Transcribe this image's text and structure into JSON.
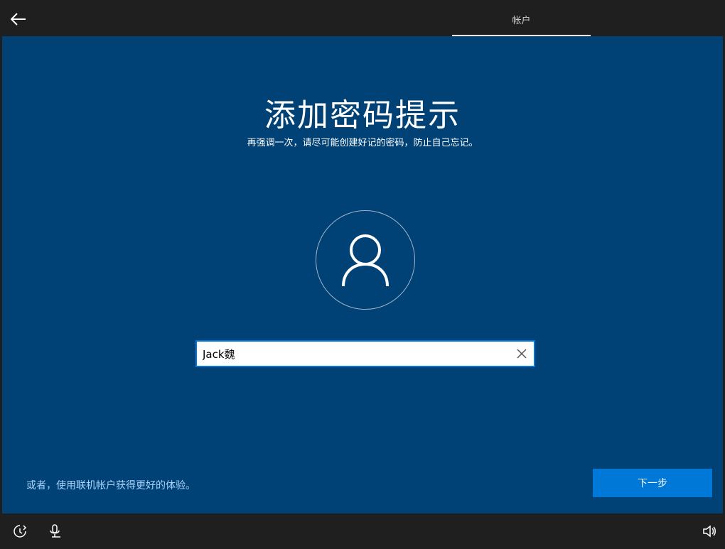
{
  "topbar": {
    "back_icon": "back-arrow-icon",
    "tab_label": "帐户"
  },
  "main": {
    "title": "添加密码提示",
    "subtitle": "再强调一次，请尽可能创建好记的密码，防止自己忘记。",
    "avatar_icon": "user-icon",
    "hint_input": {
      "value": "Jack魏",
      "clear_icon": "close-icon"
    },
    "online_account_link": "或者，使用联机帐户获得更好的体验。",
    "next_button": "下一步"
  },
  "bottombar": {
    "ease_of_access_icon": "ease-of-access-icon",
    "microphone_icon": "microphone-icon",
    "volume_icon": "volume-icon"
  },
  "colors": {
    "background": "#004275",
    "accent": "#0078d7",
    "bar": "#1f1f1f",
    "link": "#a9d3ff"
  }
}
